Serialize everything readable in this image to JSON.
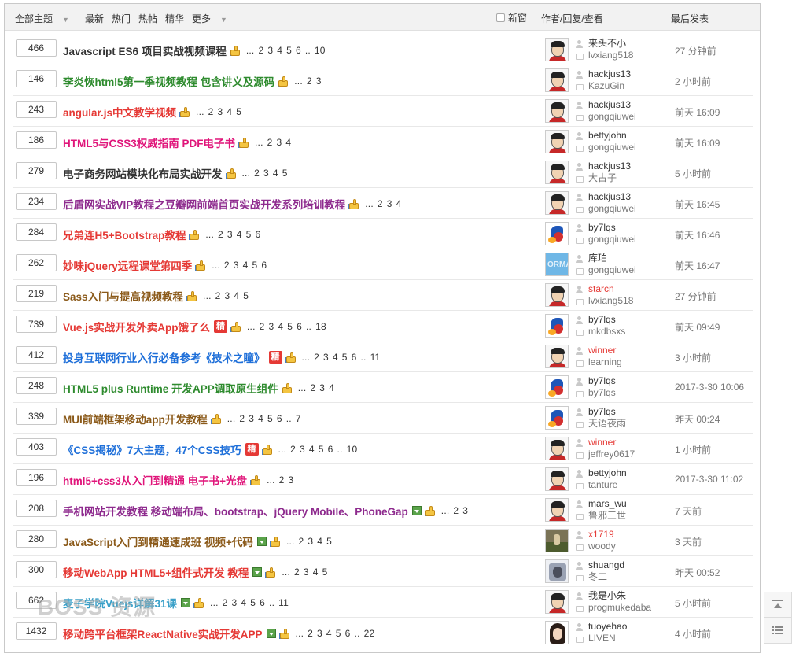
{
  "header": {
    "filter_all": "全部主题",
    "filter_latest": "最新",
    "filter_hot": "热门",
    "filter_hotpost": "热帖",
    "filter_digest": "精华",
    "filter_more": "更多",
    "new_window": "新窗",
    "col_author": "作者/回复/查看",
    "col_last": "最后发表"
  },
  "watermark": "BOSS 资源",
  "colors": {
    "black": "#333333",
    "green": "#2e8b2e",
    "red": "#e53935",
    "pink": "#e0157a",
    "purple": "#8e2b8e",
    "brown": "#8b5a1a",
    "blue": "#1e6fd9",
    "teal": "#3aa0c8"
  },
  "threads": [
    {
      "count": "466",
      "title": "Javascript ES6 项目实战视频课程",
      "color": "black",
      "jing": false,
      "img": false,
      "pages": [
        "...",
        "2",
        "3",
        "4",
        "5",
        "6",
        "..",
        "10"
      ],
      "avatar": "boy",
      "author": "来头不小",
      "author_red": false,
      "replier": "lvxiang518",
      "last": "27 分钟前"
    },
    {
      "count": "146",
      "title": "李炎恢html5第一季视频教程 包含讲义及源码",
      "color": "green",
      "jing": false,
      "img": false,
      "pages": [
        "...",
        "2",
        "3"
      ],
      "avatar": "boy",
      "author": "hackjus13",
      "author_red": false,
      "replier": "KazuGin",
      "last": "2 小时前"
    },
    {
      "count": "243",
      "title": "angular.js中文教学视频",
      "color": "red",
      "jing": false,
      "img": false,
      "pages": [
        "...",
        "2",
        "3",
        "4",
        "5"
      ],
      "avatar": "boy",
      "author": "hackjus13",
      "author_red": false,
      "replier": "gongqiuwei",
      "last": "前天 16:09"
    },
    {
      "count": "186",
      "title": "HTML5与CSS3权威指南 PDF电子书",
      "color": "pink",
      "jing": false,
      "img": false,
      "pages": [
        "...",
        "2",
        "3",
        "4"
      ],
      "avatar": "boy",
      "author": "bettyjohn",
      "author_red": false,
      "replier": "gongqiuwei",
      "last": "前天 16:09"
    },
    {
      "count": "279",
      "title": "电子商务网站模块化布局实战开发",
      "color": "black",
      "jing": false,
      "img": false,
      "pages": [
        "...",
        "2",
        "3",
        "4",
        "5"
      ],
      "avatar": "boy",
      "author": "hackjus13",
      "author_red": false,
      "replier": "大古子",
      "last": "5 小时前"
    },
    {
      "count": "234",
      "title": "后盾网实战VIP教程之豆瓣网前端首页实战开发系列培训教程",
      "color": "purple",
      "jing": false,
      "img": false,
      "pages": [
        "...",
        "2",
        "3",
        "4"
      ],
      "avatar": "boy",
      "author": "hackjus13",
      "author_red": false,
      "replier": "gongqiuwei",
      "last": "前天 16:45"
    },
    {
      "count": "284",
      "title": "兄弟连H5+Bootstrap教程",
      "color": "red",
      "jing": false,
      "img": false,
      "pages": [
        "...",
        "2",
        "3",
        "4",
        "5",
        "6"
      ],
      "avatar": "bird",
      "author": "by7lqs",
      "author_red": false,
      "replier": "gongqiuwei",
      "last": "前天 16:46"
    },
    {
      "count": "262",
      "title": "妙味jQuery远程课堂第四季",
      "color": "red",
      "jing": false,
      "img": false,
      "pages": [
        "...",
        "2",
        "3",
        "4",
        "5",
        "6"
      ],
      "avatar": "blue",
      "author": "库珀",
      "author_red": false,
      "replier": "gongqiuwei",
      "last": "前天 16:47"
    },
    {
      "count": "219",
      "title": "Sass入门与提高视频教程",
      "color": "brown",
      "jing": false,
      "img": false,
      "pages": [
        "...",
        "2",
        "3",
        "4",
        "5"
      ],
      "avatar": "boy",
      "author": "starcn",
      "author_red": true,
      "replier": "lvxiang518",
      "last": "27 分钟前"
    },
    {
      "count": "739",
      "title": "Vue.js实战开发外卖App饿了么",
      "color": "red",
      "jing": true,
      "img": false,
      "pages": [
        "...",
        "2",
        "3",
        "4",
        "5",
        "6",
        "..",
        "18"
      ],
      "avatar": "bird",
      "author": "by7lqs",
      "author_red": false,
      "replier": "mkdbsxs",
      "last": "前天 09:49"
    },
    {
      "count": "412",
      "title": "投身互联网行业入行必备参考《技术之瞳》",
      "color": "blue",
      "jing": true,
      "img": false,
      "pages": [
        "...",
        "2",
        "3",
        "4",
        "5",
        "6",
        "..",
        "11"
      ],
      "avatar": "boy",
      "author": "winner",
      "author_red": true,
      "replier": "learning",
      "last": "3 小时前"
    },
    {
      "count": "248",
      "title": "HTML5 plus Runtime 开发APP调取原生组件",
      "color": "green",
      "jing": false,
      "img": false,
      "pages": [
        "...",
        "2",
        "3",
        "4"
      ],
      "avatar": "bird",
      "author": "by7lqs",
      "author_red": false,
      "replier": "by7lqs",
      "last": "2017-3-30 10:06"
    },
    {
      "count": "339",
      "title": "MUI前端框架移动app开发教程",
      "color": "brown",
      "jing": false,
      "img": false,
      "pages": [
        "...",
        "2",
        "3",
        "4",
        "5",
        "6",
        "..",
        "7"
      ],
      "avatar": "bird",
      "author": "by7lqs",
      "author_red": false,
      "replier": "天语夜雨",
      "last": "昨天 00:24"
    },
    {
      "count": "403",
      "title": "《CSS揭秘》7大主题，47个CSS技巧",
      "color": "blue",
      "jing": true,
      "img": false,
      "pages": [
        "...",
        "2",
        "3",
        "4",
        "5",
        "6",
        "..",
        "10"
      ],
      "avatar": "boy",
      "author": "winner",
      "author_red": true,
      "replier": "jeffrey0617",
      "last": "1 小时前"
    },
    {
      "count": "196",
      "title": "html5+css3从入门到精通 电子书+光盘",
      "color": "pink",
      "jing": false,
      "img": false,
      "pages": [
        "...",
        "2",
        "3"
      ],
      "avatar": "boy",
      "author": "bettyjohn",
      "author_red": false,
      "replier": "tanture",
      "last": "2017-3-30 11:02"
    },
    {
      "count": "208",
      "title": "手机网站开发教程 移动端布局、bootstrap、jQuery Mobile、PhoneGap",
      "color": "purple",
      "jing": false,
      "img": true,
      "pages": [
        "...",
        "2",
        "3"
      ],
      "avatar": "boy",
      "author": "mars_wu",
      "author_red": false,
      "replier": "鲁邪三世",
      "last": "7 天前"
    },
    {
      "count": "280",
      "title": "JavaScript入门到精通速成班 视频+代码",
      "color": "brown",
      "jing": false,
      "img": true,
      "pages": [
        "...",
        "2",
        "3",
        "4",
        "5"
      ],
      "avatar": "photo",
      "author": "x1719",
      "author_red": true,
      "replier": "woody",
      "last": "3 天前"
    },
    {
      "count": "300",
      "title": "移动WebApp HTML5+组件式开发 教程",
      "color": "red",
      "jing": false,
      "img": true,
      "pages": [
        "...",
        "2",
        "3",
        "4",
        "5"
      ],
      "avatar": "photo2",
      "author": "shuangd",
      "author_red": false,
      "replier": "冬二",
      "last": "昨天 00:52"
    },
    {
      "count": "662",
      "title": "麦子学院Vuejs详解31课",
      "color": "teal",
      "jing": false,
      "img": true,
      "pages": [
        "...",
        "2",
        "3",
        "4",
        "5",
        "6",
        "..",
        "11"
      ],
      "avatar": "boy",
      "author": "我是小朱",
      "author_red": false,
      "replier": "progmukedaba",
      "last": "5 小时前"
    },
    {
      "count": "1432",
      "title": "移动跨平台框架ReactNative实战开发APP",
      "color": "red",
      "jing": false,
      "img": true,
      "pages": [
        "...",
        "2",
        "3",
        "4",
        "5",
        "6",
        "..",
        "22"
      ],
      "avatar": "girl",
      "author": "tuoyehao",
      "author_red": false,
      "replier": "LIVEN",
      "last": "4 小时前"
    }
  ],
  "jing_label": "精",
  "avatar_blue_text": "ORMA"
}
